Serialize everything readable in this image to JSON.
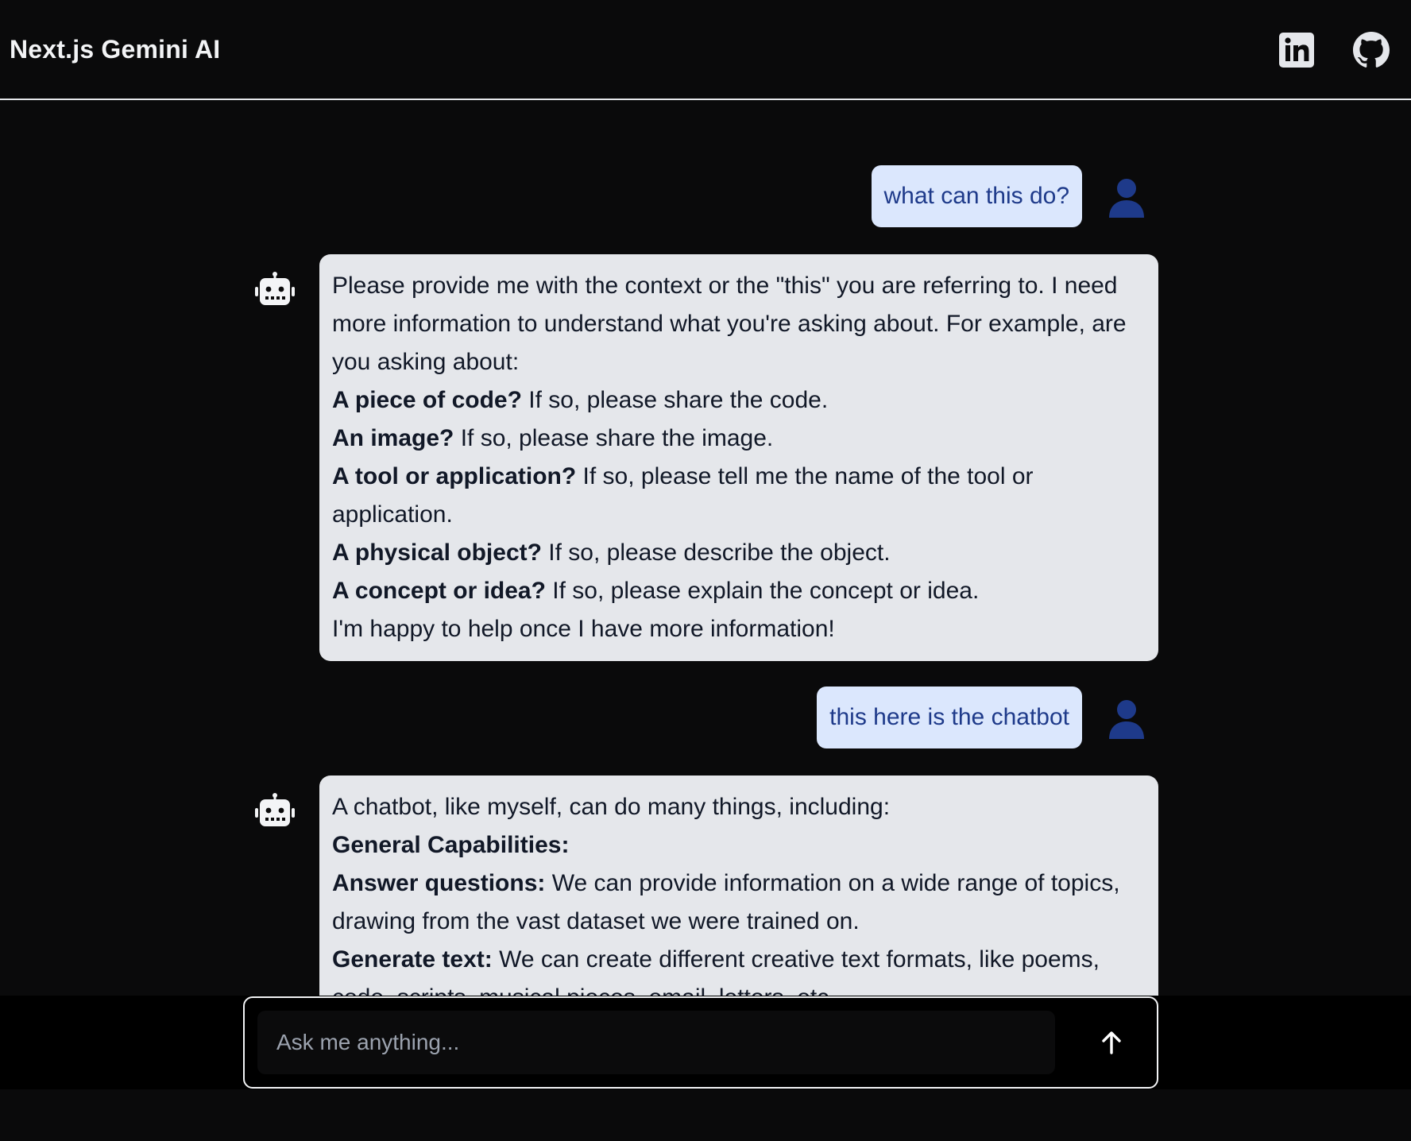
{
  "header": {
    "title": "Next.js Gemini AI",
    "linkedin_icon": "linkedin-icon",
    "github_icon": "github-icon"
  },
  "messages": [
    {
      "role": "user",
      "text": "what can this do?"
    },
    {
      "role": "bot",
      "lines": [
        {
          "bold": "",
          "text": "Please provide me with the context or the \"this\" you are referring to. I need more information to understand what you're asking about. For example, are you asking about:"
        },
        {
          "bold": "A piece of code?",
          "text": " If so, please share the code."
        },
        {
          "bold": "An image?",
          "text": " If so, please share the image."
        },
        {
          "bold": "A tool or application?",
          "text": " If so, please tell me the name of the tool or application."
        },
        {
          "bold": "A physical object?",
          "text": " If so, please describe the object."
        },
        {
          "bold": "A concept or idea?",
          "text": " If so, please explain the concept or idea."
        },
        {
          "bold": "",
          "text": "I'm happy to help once I have more information!"
        }
      ]
    },
    {
      "role": "user",
      "text": "this here is the chatbot"
    },
    {
      "role": "bot",
      "lines": [
        {
          "bold": "",
          "text": "A chatbot, like myself, can do many things, including:"
        },
        {
          "bold": "General Capabilities:",
          "text": ""
        },
        {
          "bold": "Answer questions:",
          "text": " We can provide information on a wide range of topics, drawing from the vast dataset we were trained on."
        },
        {
          "bold": "Generate text:",
          "text": " We can create different creative text formats, like poems, code, scripts, musical pieces, email, letters, etc."
        }
      ]
    }
  ],
  "composer": {
    "placeholder": "Ask me anything...",
    "send_icon": "arrow-up-icon"
  },
  "colors": {
    "background": "#0a0a0b",
    "user_bubble": "#dbe7fd",
    "user_text": "#1e3a8a",
    "bot_bubble": "#e5e7eb",
    "avatar": "#1e3a8a"
  }
}
